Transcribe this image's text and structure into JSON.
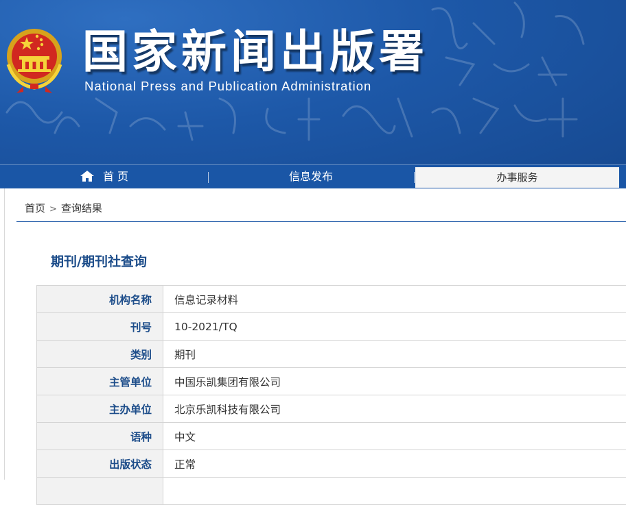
{
  "header": {
    "title_cn": "国家新闻出版署",
    "title_en": "National  Press and Publication Administration",
    "emblem_icon": "national-emblem-icon",
    "background_color": "#1d58a8"
  },
  "nav": {
    "home_label": "首 页",
    "home_icon": "house-icon",
    "info_label": "信息发布",
    "service_label": "办事服务",
    "active": "办事服务"
  },
  "breadcrumb": {
    "home": "首页",
    "separator": ">",
    "current": "查询结果"
  },
  "section_title": "期刊/期刊社查询",
  "rows": [
    {
      "label": "机构名称",
      "value": "信息记录材料"
    },
    {
      "label": "刊号",
      "value": "10-2021/TQ"
    },
    {
      "label": "类别",
      "value": "期刊"
    },
    {
      "label": "主管单位",
      "value": "中国乐凯集团有限公司"
    },
    {
      "label": "主办单位",
      "value": "北京乐凯科技有限公司"
    },
    {
      "label": "语种",
      "value": "中文"
    },
    {
      "label": "出版状态",
      "value": "正常"
    }
  ],
  "colors": {
    "accent": "#1a56a6",
    "label_text": "#1d4d8a",
    "label_bg": "#f2f2f2"
  }
}
